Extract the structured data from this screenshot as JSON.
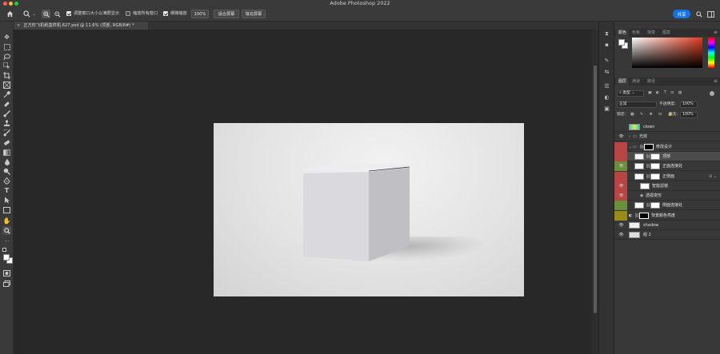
{
  "app": {
    "title": "Adobe Photoshop 2022"
  },
  "options_bar": {
    "zoom_level": "100%",
    "resize_windows_label": "调整窗口大小以满屏显示",
    "zoom_all_label": "缩放所有窗口",
    "scrubby_zoom_label": "细微缩放",
    "fit_screen_label": "适合屏幕",
    "fill_screen_label": "填充屏幕",
    "share_label": "共享"
  },
  "document": {
    "tab_title": "正方形飞机纸盒样机.627.psd @ 11.6% (顶部, RGB/8#) *"
  },
  "color_panel": {
    "tabs": [
      "颜色",
      "色板",
      "渐变",
      "图案"
    ],
    "hue_color": "#e23a1e"
  },
  "layers_panel": {
    "tabs": [
      "图层",
      "通道",
      "路径"
    ],
    "filter_kind": "类型",
    "blend_mode": "正常",
    "opacity_label": "不透明度:",
    "opacity_value": "100%",
    "lock_label": "锁定:",
    "fill_label": "填充:",
    "fill_value": "100%",
    "layers": [
      {
        "name": "clown",
        "visible": false,
        "color": "",
        "indent": 0,
        "kind": "pixel"
      },
      {
        "name": "光效",
        "visible": true,
        "color": "",
        "indent": 0,
        "kind": "group"
      },
      {
        "name": "修改设计",
        "visible": false,
        "color": "#b84444",
        "indent": 0,
        "kind": "group"
      },
      {
        "name": "顶部",
        "visible": false,
        "color": "#b84444",
        "indent": 1,
        "kind": "smart"
      },
      {
        "name": "正面连接处",
        "visible": true,
        "color": "#6b8f3a",
        "indent": 1,
        "kind": "smart"
      },
      {
        "name": "正侧面",
        "visible": false,
        "color": "#b84444",
        "indent": 1,
        "kind": "smart"
      },
      {
        "name": "智能滤镜",
        "visible": true,
        "color": "#b84444",
        "indent": 2,
        "kind": "filter"
      },
      {
        "name": "透视变形",
        "visible": true,
        "color": "#b84444",
        "indent": 3,
        "kind": "filteritem"
      },
      {
        "name": "侧面连接处",
        "visible": false,
        "color": "#6b8f3a",
        "indent": 1,
        "kind": "smart"
      },
      {
        "name": "背景颜色亮度",
        "visible": false,
        "color": "#9a8a18",
        "indent": 0,
        "kind": "adjust"
      },
      {
        "name": "shadow",
        "visible": true,
        "color": "",
        "indent": 0,
        "kind": "pixel"
      },
      {
        "name": "组 2",
        "visible": true,
        "color": "",
        "indent": 0,
        "kind": "pixelbox"
      }
    ]
  }
}
